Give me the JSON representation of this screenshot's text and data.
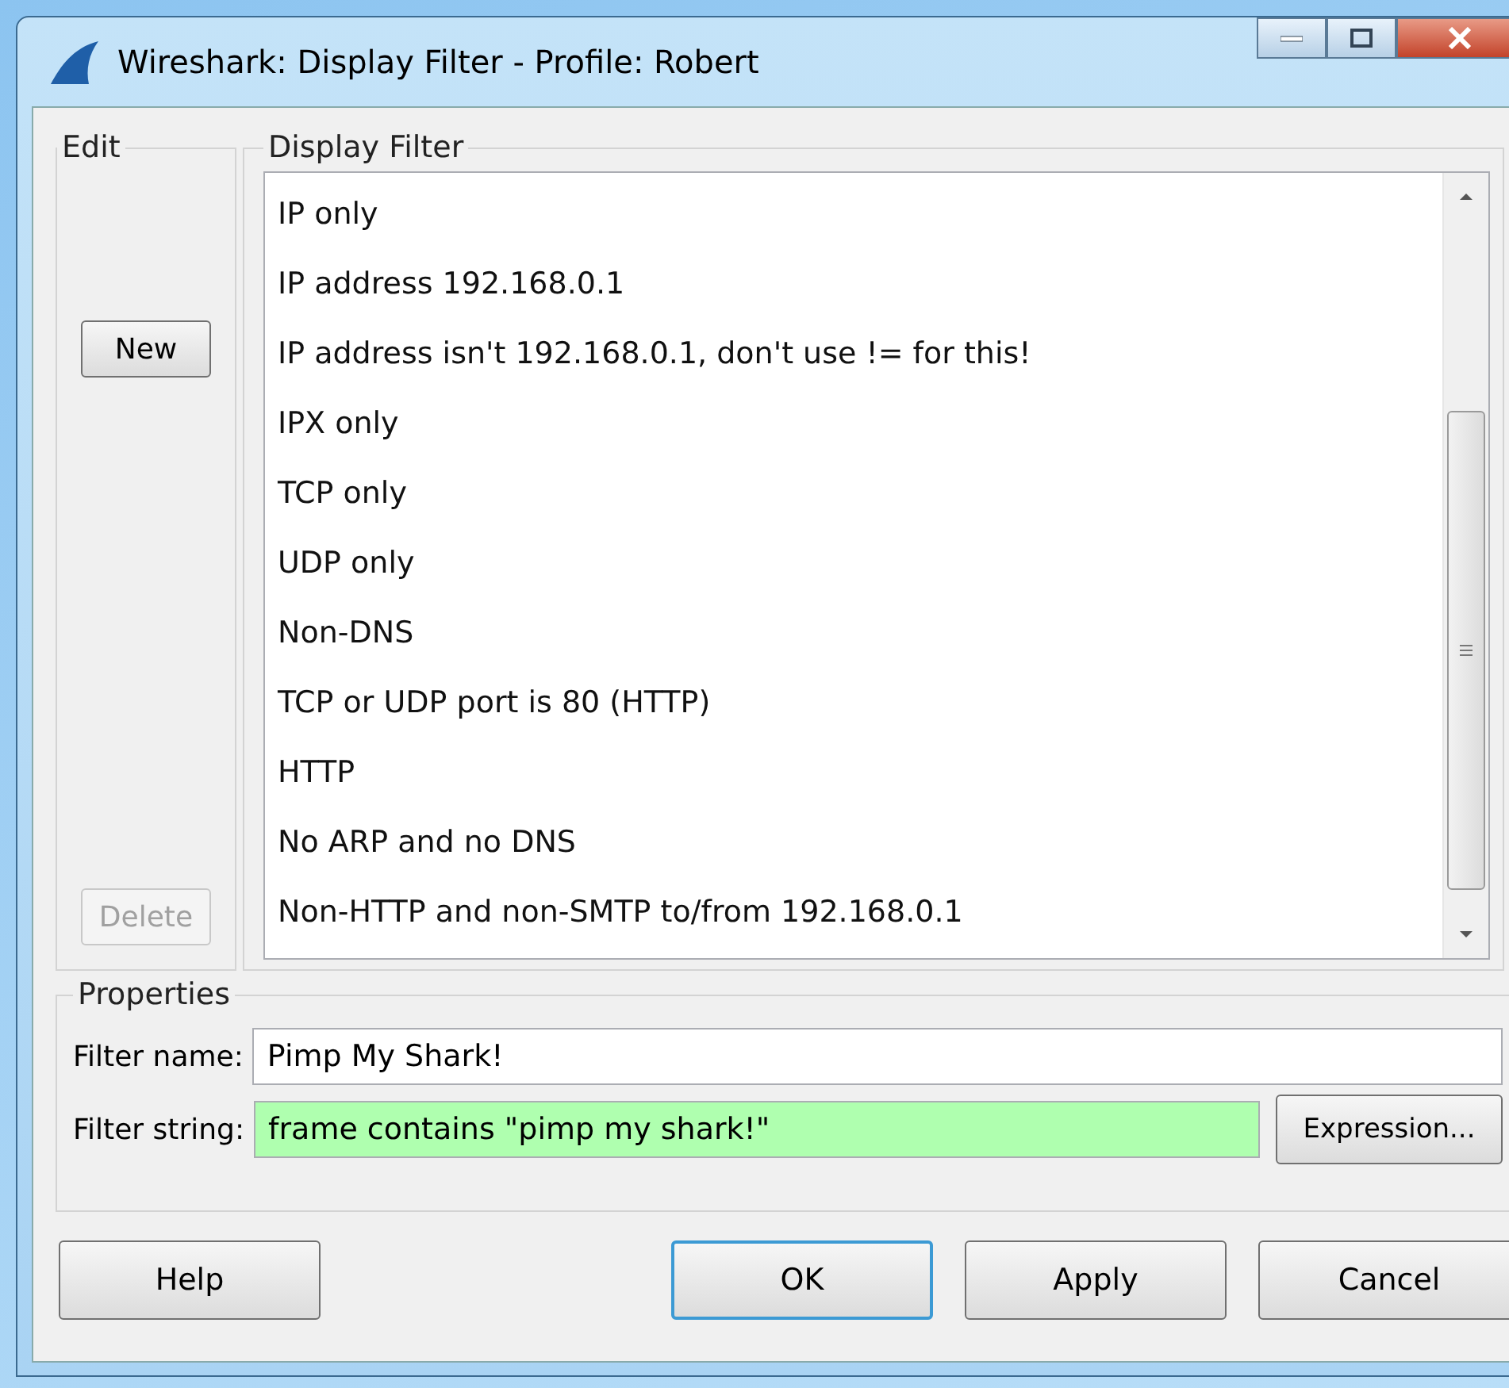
{
  "window": {
    "title": "Wireshark: Display Filter - Profile: Robert"
  },
  "edit_group": {
    "title": "Edit",
    "buttons": [
      {
        "label": "New",
        "disabled": false
      },
      {
        "label": "Delete",
        "disabled": true
      }
    ]
  },
  "filter_group": {
    "title": "Display Filter",
    "items": [
      {
        "label": "IP only"
      },
      {
        "label": "IP address 192.168.0.1"
      },
      {
        "label": "IP address isn't 192.168.0.1, don't use != for this!"
      },
      {
        "label": "IPX only"
      },
      {
        "label": "TCP only"
      },
      {
        "label": "UDP only"
      },
      {
        "label": "Non-DNS"
      },
      {
        "label": "TCP or UDP port is 80 (HTTP)"
      },
      {
        "label": "HTTP"
      },
      {
        "label": "No ARP and no DNS"
      },
      {
        "label": "Non-HTTP and non-SMTP to/from 192.168.0.1"
      }
    ]
  },
  "properties": {
    "title": "Properties",
    "name_label": "Filter name:",
    "name_value": "Pimp My Shark!",
    "string_label": "Filter string:",
    "string_value": "frame contains \"pimp my shark!\"",
    "string_valid": true,
    "expression_button": "Expression..."
  },
  "buttons": [
    {
      "label": "Help",
      "kind": "left",
      "default": false
    },
    {
      "label": "OK",
      "kind": "right",
      "default": true
    },
    {
      "label": "Apply",
      "kind": "right",
      "default": false
    },
    {
      "label": "Cancel",
      "kind": "right",
      "default": false
    }
  ]
}
